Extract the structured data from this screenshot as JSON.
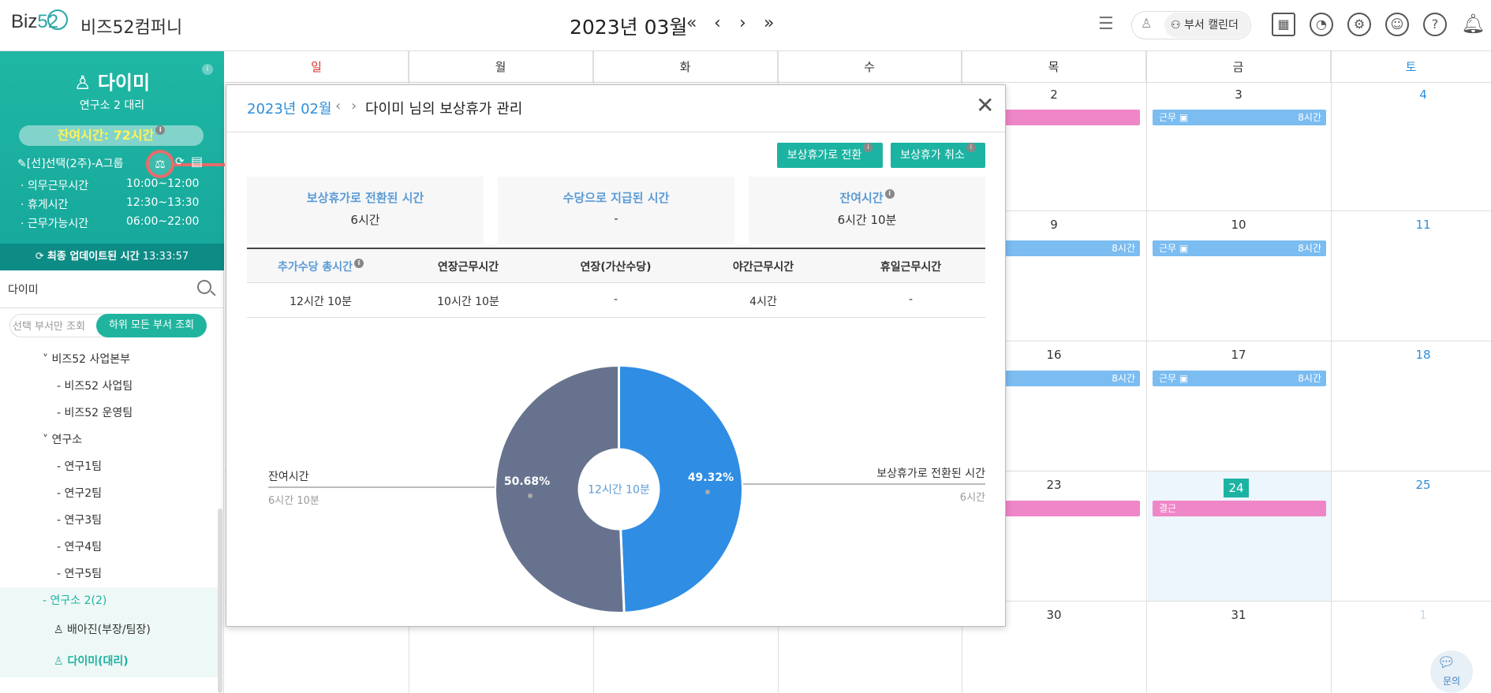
{
  "header": {
    "logo_text": "Biz",
    "logo_num": "52",
    "company": "비즈52컴퍼니",
    "month_title": "2023년 03월",
    "nav": [
      "«",
      "‹",
      "›",
      "»"
    ],
    "dept_calendar_label": "부서 캘린더"
  },
  "sidebar": {
    "name": "다이미",
    "role": "연구소 2 대리",
    "remaining": "잔여시간: 72시간",
    "group": "[선]선택(2주)-A그룹",
    "rows": [
      {
        "label": "· 의무근무시간",
        "value": "10:00~12:00"
      },
      {
        "label": "· 휴게시간",
        "value": "12:30~13:30"
      },
      {
        "label": "· 근무가능시간",
        "value": "06:00~22:00"
      }
    ],
    "updated_label": "최종 업데이트된 시간",
    "updated_time": "13:33:57",
    "search_value": "다이미",
    "toggle_a": "선택 부서만 조회",
    "toggle_b": "하위 모든 부서 조회",
    "tree": [
      "˅ 비즈52 사업본부",
      "- 비즈52 사업팀",
      "- 비즈52 운영팀",
      "˅ 연구소",
      "- 연구1팀",
      "- 연구2팀",
      "- 연구3팀",
      "- 연구4팀",
      "- 연구5팀",
      "- 연구소 2(2)",
      "배아진(부장/팀장)",
      "다이미(대리)"
    ]
  },
  "calendar": {
    "weekdays": [
      "일",
      "월",
      "화",
      "수",
      "목",
      "금",
      "토"
    ],
    "weekday_colors": [
      "#d9342b",
      "#333333",
      "#333333",
      "#333333",
      "#333333",
      "#333333",
      "#2d8ed9"
    ],
    "days": {
      "r0": [
        "2",
        "3",
        "4"
      ],
      "r1": [
        "9",
        "10",
        "11"
      ],
      "r2": [
        "16",
        "17",
        "18"
      ],
      "r3": [
        "23",
        "24",
        "25"
      ],
      "r4": [
        "30",
        "31",
        "1"
      ]
    },
    "event_work": "근무",
    "event_hours": "8시간",
    "event_absence": "결근",
    "chat_label": "문의"
  },
  "modal": {
    "month": "2023년 02월",
    "prev": "‹",
    "next": "›",
    "title": "다이미 님의 보상휴가 관리",
    "close": "✕",
    "btn_convert": "보상휴가로 전환",
    "btn_cancel": "보상휴가 취소",
    "cards": [
      {
        "title": "보상휴가로 전환된 시간",
        "value": "6시간"
      },
      {
        "title": "수당으로 지급된 시간",
        "value": "-"
      },
      {
        "title": "잔여시간",
        "value": "6시간 10분"
      }
    ],
    "table_headers": [
      "추가수당 총시간",
      "연장근무시간",
      "연장(가산수당)",
      "야간근무시간",
      "휴일근무시간"
    ],
    "table_values": [
      "12시간 10분",
      "10시간 10분",
      "-",
      "4시간",
      "-"
    ],
    "chart_labels": {
      "left_title": "잔여시간",
      "left_sub": "6시간 10분",
      "right_title": "보상휴가로 전환된 시간",
      "right_sub": "6시간",
      "center": "12시간 10분"
    }
  },
  "chart_data": {
    "type": "pie",
    "donut": true,
    "slices": [
      {
        "name": "보상휴가로 전환된 시간",
        "value": 49.32,
        "label": "49.32%",
        "color": "#2f8de4"
      },
      {
        "name": "잔여시간",
        "value": 50.68,
        "label": "50.68%",
        "color": "#67738e"
      }
    ],
    "center_text": "12시간 10분"
  }
}
